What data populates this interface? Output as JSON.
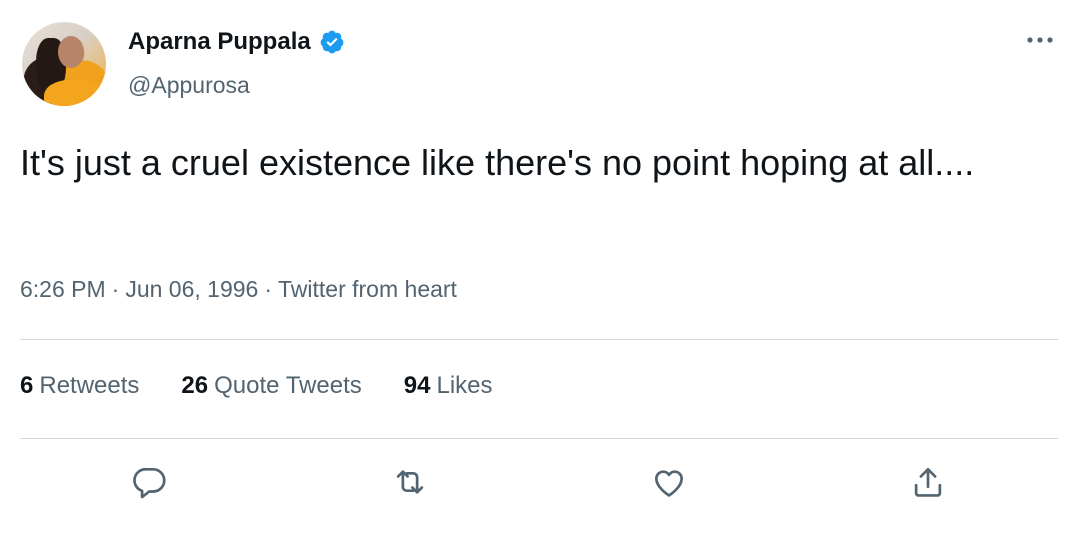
{
  "author": {
    "name": "Aparna Puppala",
    "handle": "@Appurosa",
    "verified": true
  },
  "tweet": {
    "text": "It's just a cruel existence like there's no point hoping at all...."
  },
  "meta": {
    "time": "6:26 PM",
    "separator": "·",
    "date": "Jun 06, 1996",
    "source": "Twitter from heart"
  },
  "stats": {
    "retweets": {
      "count": "6",
      "label": "Retweets"
    },
    "quotes": {
      "count": "26",
      "label": "Quote Tweets"
    },
    "likes": {
      "count": "94",
      "label": "Likes"
    }
  },
  "actions": [
    "reply-icon",
    "retweet-icon",
    "like-icon",
    "share-icon"
  ],
  "colors": {
    "text_primary": "#0f1419",
    "text_secondary": "#536471",
    "verified": "#1d9bf0",
    "divider": "#cfd9de"
  }
}
